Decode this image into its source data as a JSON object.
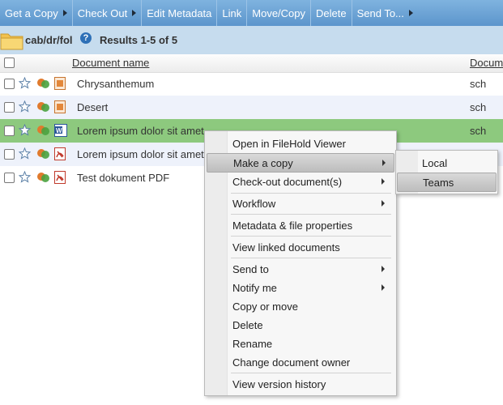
{
  "toolbar": {
    "items": [
      {
        "label": "Get a Copy",
        "has_submenu": true
      },
      {
        "label": "Check Out",
        "has_submenu": true
      },
      {
        "label": "Edit Metadata",
        "has_submenu": false
      },
      {
        "label": "Link",
        "has_submenu": false
      },
      {
        "label": "Move/Copy",
        "has_submenu": false
      },
      {
        "label": "Delete",
        "has_submenu": false
      },
      {
        "label": "Send To...",
        "has_submenu": true
      }
    ]
  },
  "location": {
    "path": "cab/dr/fol",
    "results": "Results 1-5 of 5"
  },
  "table": {
    "columns": [
      "Document name",
      "Docum"
    ],
    "rows": [
      {
        "name": "Chrysanthemum",
        "owner": "sch",
        "file_type": "image-icon",
        "state": "normal"
      },
      {
        "name": "Desert",
        "owner": "sch",
        "file_type": "image-icon",
        "state": "alt"
      },
      {
        "name": "Lorem ipsum dolor sit amet",
        "owner": "sch",
        "file_type": "word-icon",
        "state": "selected"
      },
      {
        "name": "Lorem ipsum dolor sit amet",
        "owner": "",
        "file_type": "pdf-icon",
        "state": "alt"
      },
      {
        "name": "Test dokument PDF",
        "owner": "",
        "file_type": "pdf-icon",
        "state": "normal"
      }
    ]
  },
  "context_menu": {
    "items": [
      {
        "label": "Open in FileHold Viewer",
        "submenu": false
      },
      {
        "label": "Make a copy",
        "submenu": true,
        "highlighted": true
      },
      {
        "label": "Check-out document(s)",
        "submenu": true
      },
      {
        "label": "Workflow",
        "submenu": true
      },
      {
        "label": "Metadata & file properties",
        "submenu": false
      },
      {
        "label": "View linked documents",
        "submenu": false
      },
      {
        "label": "Send to",
        "submenu": true
      },
      {
        "label": "Notify me",
        "submenu": true
      },
      {
        "label": "Copy or move",
        "submenu": false
      },
      {
        "label": "Delete",
        "submenu": false
      },
      {
        "label": "Rename",
        "submenu": false
      },
      {
        "label": "Change document owner",
        "submenu": false
      },
      {
        "label": "View version history",
        "submenu": false
      }
    ]
  },
  "submenu": {
    "items": [
      {
        "label": "Local"
      },
      {
        "label": "Teams",
        "highlighted": true
      }
    ]
  },
  "colors": {
    "toolbar": "#6fa6d8",
    "path_bar": "#c6dcee",
    "selected_row": "#8dc97e",
    "alt_row": "#eef2fb"
  }
}
